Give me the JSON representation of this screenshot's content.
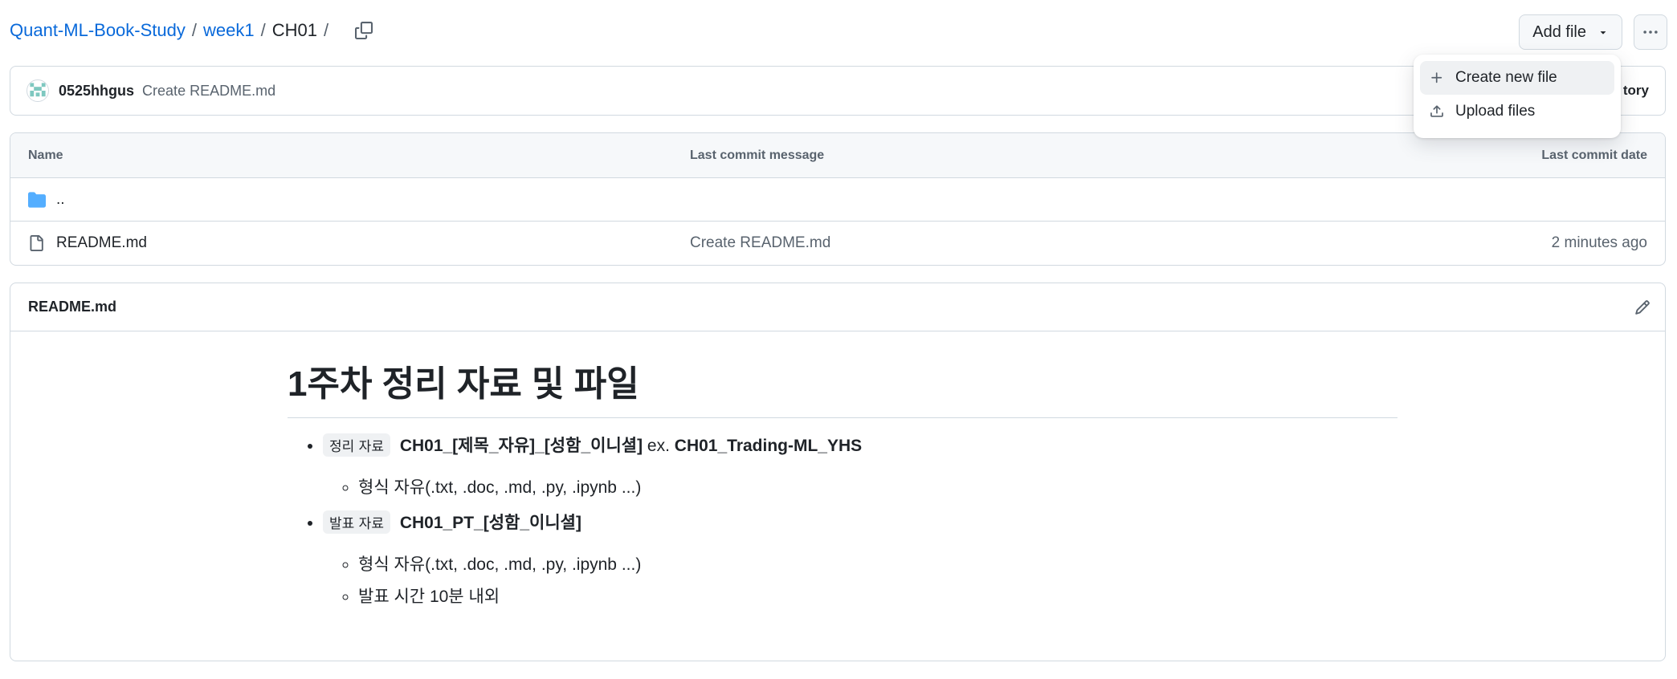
{
  "breadcrumb": {
    "repo": "Quant-ML-Book-Study",
    "folder": "week1",
    "current": "CH01",
    "separator": "/"
  },
  "actions": {
    "add_file_label": "Add file"
  },
  "dropdown": {
    "items": [
      {
        "label": "Create new file",
        "icon": "plus-icon"
      },
      {
        "label": "Upload files",
        "icon": "upload-icon"
      }
    ]
  },
  "commit": {
    "author": "0525hhgus",
    "message": "Create README.md",
    "history_partial": "tory"
  },
  "files": {
    "headers": {
      "name": "Name",
      "message": "Last commit message",
      "date": "Last commit date"
    },
    "parent_dir": "..",
    "rows": [
      {
        "name": "README.md",
        "message": "Create README.md",
        "date": "2 minutes ago"
      }
    ]
  },
  "readme": {
    "filename": "README.md",
    "title": "1주차 정리 자료 및 파일",
    "items": [
      {
        "tag": "정리 자료",
        "bold": "CH01_[제목_자유]_[성함_이니셜]",
        "extra_prefix": "ex.",
        "extra_bold": "CH01_Trading-ML_YHS",
        "sub": [
          "형식 자유(.txt, .doc, .md, .py, .ipynb ...)"
        ]
      },
      {
        "tag": "발표 자료",
        "bold": "CH01_PT_[성함_이니셜]",
        "sub": [
          "형식 자유(.txt, .doc, .md, .py, .ipynb ...)",
          "발표 시간 10분 내외"
        ]
      }
    ]
  },
  "colors": {
    "link": "#0969da",
    "folder_icon": "#54aeff",
    "border": "#d1d9e0",
    "muted": "#59636e"
  }
}
